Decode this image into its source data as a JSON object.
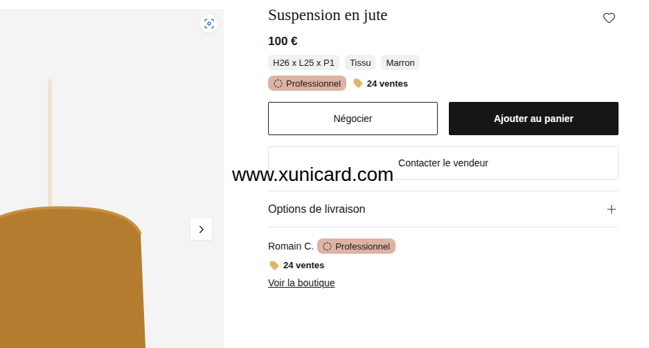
{
  "product": {
    "title": "Suspension en jute",
    "price": "100 €",
    "favorite": false,
    "attributes": [
      "H26 x L25 x P1",
      "Tissu",
      "Marron"
    ],
    "badge": "Professionnel",
    "sales": "24 ventes"
  },
  "actions": {
    "negotiate": "Négocier",
    "add_to_cart": "Ajouter au panier",
    "contact": "Contacter le vendeur"
  },
  "delivery": {
    "label": "Options de livraison",
    "expanded": false
  },
  "seller": {
    "name": "Romain C.",
    "badge": "Professionnel",
    "sales": "24 ventes",
    "shop_link": "Voir la boutique"
  },
  "watermark": "www.xunicard.com"
}
